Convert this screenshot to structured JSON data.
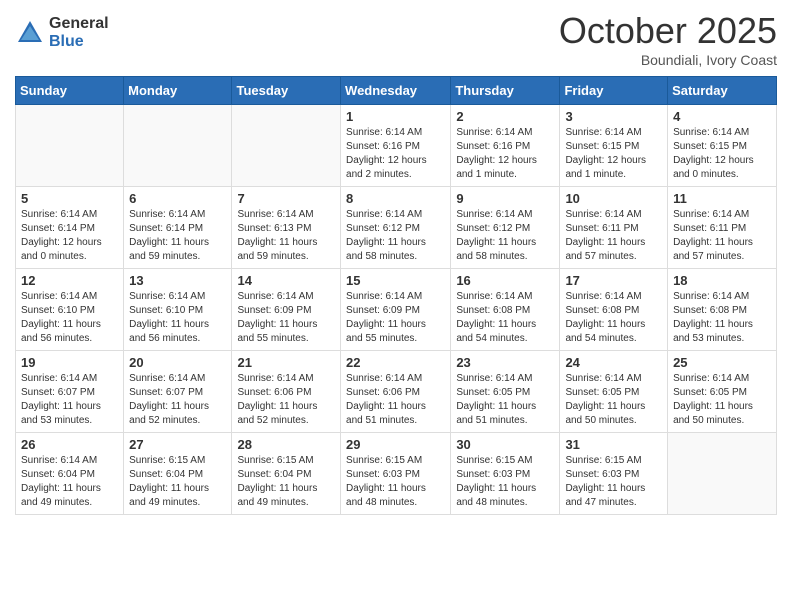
{
  "logo": {
    "general": "General",
    "blue": "Blue"
  },
  "header": {
    "month": "October 2025",
    "location": "Boundiali, Ivory Coast"
  },
  "weekdays": [
    "Sunday",
    "Monday",
    "Tuesday",
    "Wednesday",
    "Thursday",
    "Friday",
    "Saturday"
  ],
  "weeks": [
    [
      {
        "day": "",
        "info": ""
      },
      {
        "day": "",
        "info": ""
      },
      {
        "day": "",
        "info": ""
      },
      {
        "day": "1",
        "info": "Sunrise: 6:14 AM\nSunset: 6:16 PM\nDaylight: 12 hours\nand 2 minutes."
      },
      {
        "day": "2",
        "info": "Sunrise: 6:14 AM\nSunset: 6:16 PM\nDaylight: 12 hours\nand 1 minute."
      },
      {
        "day": "3",
        "info": "Sunrise: 6:14 AM\nSunset: 6:15 PM\nDaylight: 12 hours\nand 1 minute."
      },
      {
        "day": "4",
        "info": "Sunrise: 6:14 AM\nSunset: 6:15 PM\nDaylight: 12 hours\nand 0 minutes."
      }
    ],
    [
      {
        "day": "5",
        "info": "Sunrise: 6:14 AM\nSunset: 6:14 PM\nDaylight: 12 hours\nand 0 minutes."
      },
      {
        "day": "6",
        "info": "Sunrise: 6:14 AM\nSunset: 6:14 PM\nDaylight: 11 hours\nand 59 minutes."
      },
      {
        "day": "7",
        "info": "Sunrise: 6:14 AM\nSunset: 6:13 PM\nDaylight: 11 hours\nand 59 minutes."
      },
      {
        "day": "8",
        "info": "Sunrise: 6:14 AM\nSunset: 6:12 PM\nDaylight: 11 hours\nand 58 minutes."
      },
      {
        "day": "9",
        "info": "Sunrise: 6:14 AM\nSunset: 6:12 PM\nDaylight: 11 hours\nand 58 minutes."
      },
      {
        "day": "10",
        "info": "Sunrise: 6:14 AM\nSunset: 6:11 PM\nDaylight: 11 hours\nand 57 minutes."
      },
      {
        "day": "11",
        "info": "Sunrise: 6:14 AM\nSunset: 6:11 PM\nDaylight: 11 hours\nand 57 minutes."
      }
    ],
    [
      {
        "day": "12",
        "info": "Sunrise: 6:14 AM\nSunset: 6:10 PM\nDaylight: 11 hours\nand 56 minutes."
      },
      {
        "day": "13",
        "info": "Sunrise: 6:14 AM\nSunset: 6:10 PM\nDaylight: 11 hours\nand 56 minutes."
      },
      {
        "day": "14",
        "info": "Sunrise: 6:14 AM\nSunset: 6:09 PM\nDaylight: 11 hours\nand 55 minutes."
      },
      {
        "day": "15",
        "info": "Sunrise: 6:14 AM\nSunset: 6:09 PM\nDaylight: 11 hours\nand 55 minutes."
      },
      {
        "day": "16",
        "info": "Sunrise: 6:14 AM\nSunset: 6:08 PM\nDaylight: 11 hours\nand 54 minutes."
      },
      {
        "day": "17",
        "info": "Sunrise: 6:14 AM\nSunset: 6:08 PM\nDaylight: 11 hours\nand 54 minutes."
      },
      {
        "day": "18",
        "info": "Sunrise: 6:14 AM\nSunset: 6:08 PM\nDaylight: 11 hours\nand 53 minutes."
      }
    ],
    [
      {
        "day": "19",
        "info": "Sunrise: 6:14 AM\nSunset: 6:07 PM\nDaylight: 11 hours\nand 53 minutes."
      },
      {
        "day": "20",
        "info": "Sunrise: 6:14 AM\nSunset: 6:07 PM\nDaylight: 11 hours\nand 52 minutes."
      },
      {
        "day": "21",
        "info": "Sunrise: 6:14 AM\nSunset: 6:06 PM\nDaylight: 11 hours\nand 52 minutes."
      },
      {
        "day": "22",
        "info": "Sunrise: 6:14 AM\nSunset: 6:06 PM\nDaylight: 11 hours\nand 51 minutes."
      },
      {
        "day": "23",
        "info": "Sunrise: 6:14 AM\nSunset: 6:05 PM\nDaylight: 11 hours\nand 51 minutes."
      },
      {
        "day": "24",
        "info": "Sunrise: 6:14 AM\nSunset: 6:05 PM\nDaylight: 11 hours\nand 50 minutes."
      },
      {
        "day": "25",
        "info": "Sunrise: 6:14 AM\nSunset: 6:05 PM\nDaylight: 11 hours\nand 50 minutes."
      }
    ],
    [
      {
        "day": "26",
        "info": "Sunrise: 6:14 AM\nSunset: 6:04 PM\nDaylight: 11 hours\nand 49 minutes."
      },
      {
        "day": "27",
        "info": "Sunrise: 6:15 AM\nSunset: 6:04 PM\nDaylight: 11 hours\nand 49 minutes."
      },
      {
        "day": "28",
        "info": "Sunrise: 6:15 AM\nSunset: 6:04 PM\nDaylight: 11 hours\nand 49 minutes."
      },
      {
        "day": "29",
        "info": "Sunrise: 6:15 AM\nSunset: 6:03 PM\nDaylight: 11 hours\nand 48 minutes."
      },
      {
        "day": "30",
        "info": "Sunrise: 6:15 AM\nSunset: 6:03 PM\nDaylight: 11 hours\nand 48 minutes."
      },
      {
        "day": "31",
        "info": "Sunrise: 6:15 AM\nSunset: 6:03 PM\nDaylight: 11 hours\nand 47 minutes."
      },
      {
        "day": "",
        "info": ""
      }
    ]
  ]
}
